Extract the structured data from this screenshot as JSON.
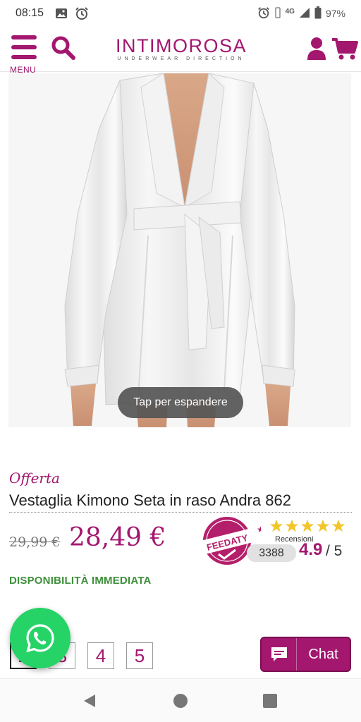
{
  "status_bar": {
    "time": "08:15",
    "network": "4G",
    "battery": "97%",
    "icons": [
      "image-icon",
      "alarm-icon",
      "alarm-icon",
      "vibrate-icon",
      "signal-icon",
      "battery-icon"
    ]
  },
  "header": {
    "menu_label": "MENU",
    "logo_text": "INTIMOROSA",
    "logo_tagline": "UNDERWEAR DIRECTION",
    "brand_color": "#a3176f",
    "icons": [
      "hamburger-icon",
      "search-icon",
      "user-icon",
      "cart-icon"
    ]
  },
  "gallery": {
    "toast": "Tap per espandere"
  },
  "product": {
    "badge": "Offerta",
    "title": "Vestaglia Kimono Seta in raso Andra 862",
    "old_price": "29,99 €",
    "price": "28,49 €",
    "availability": "DISPONIBILITÀ IMMEDIATA",
    "availability_color": "#3d8f3a"
  },
  "reviews": {
    "provider": "FEEDATY",
    "label": "Recensioni",
    "count": "3388",
    "rating": "4.9",
    "rating_max": "/ 5",
    "stars": 5
  },
  "sizes": {
    "options": [
      "2",
      "3",
      "4",
      "5"
    ],
    "selected": "2"
  },
  "chat": {
    "label": "Chat"
  }
}
